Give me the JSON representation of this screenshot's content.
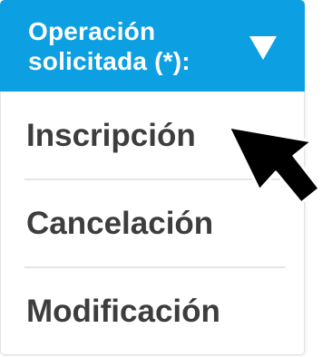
{
  "dropdown": {
    "label_line1": "Operación",
    "label_line2": "solicitada (*):",
    "toggle_icon": "caret-down-icon",
    "options": [
      {
        "label": "Inscripción"
      },
      {
        "label": "Cancelación"
      },
      {
        "label": "Modificación"
      }
    ]
  },
  "cursor": {
    "icon": "mouse-pointer-icon"
  },
  "colors": {
    "header_background": "#0ca0e3",
    "header_text": "#ffffff",
    "option_text": "#3d3d3d",
    "divider": "#e6e6e6"
  }
}
